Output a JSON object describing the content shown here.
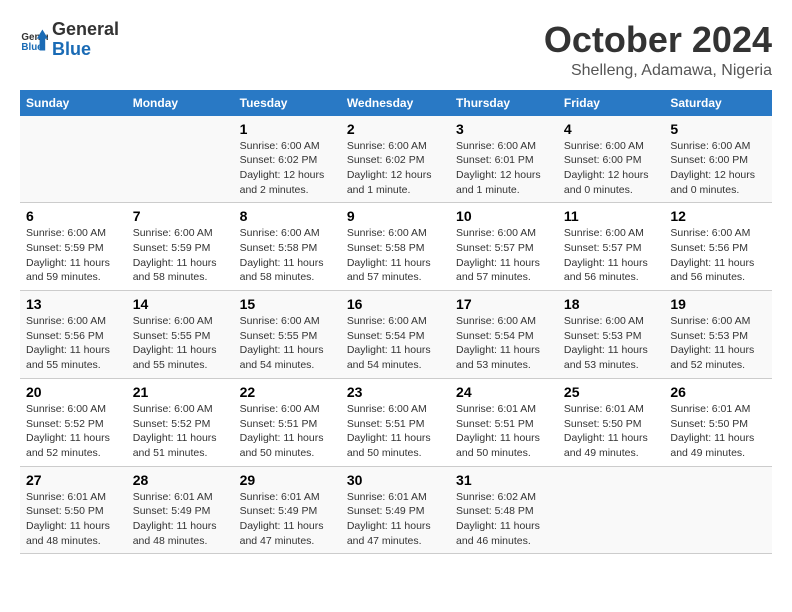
{
  "logo": {
    "line1": "General",
    "line2": "Blue"
  },
  "title": "October 2024",
  "subtitle": "Shelleng, Adamawa, Nigeria",
  "headers": [
    "Sunday",
    "Monday",
    "Tuesday",
    "Wednesday",
    "Thursday",
    "Friday",
    "Saturday"
  ],
  "weeks": [
    [
      {
        "day": "",
        "sunrise": "",
        "sunset": "",
        "daylight": ""
      },
      {
        "day": "",
        "sunrise": "",
        "sunset": "",
        "daylight": ""
      },
      {
        "day": "1",
        "sunrise": "Sunrise: 6:00 AM",
        "sunset": "Sunset: 6:02 PM",
        "daylight": "Daylight: 12 hours and 2 minutes."
      },
      {
        "day": "2",
        "sunrise": "Sunrise: 6:00 AM",
        "sunset": "Sunset: 6:02 PM",
        "daylight": "Daylight: 12 hours and 1 minute."
      },
      {
        "day": "3",
        "sunrise": "Sunrise: 6:00 AM",
        "sunset": "Sunset: 6:01 PM",
        "daylight": "Daylight: 12 hours and 1 minute."
      },
      {
        "day": "4",
        "sunrise": "Sunrise: 6:00 AM",
        "sunset": "Sunset: 6:00 PM",
        "daylight": "Daylight: 12 hours and 0 minutes."
      },
      {
        "day": "5",
        "sunrise": "Sunrise: 6:00 AM",
        "sunset": "Sunset: 6:00 PM",
        "daylight": "Daylight: 12 hours and 0 minutes."
      }
    ],
    [
      {
        "day": "6",
        "sunrise": "Sunrise: 6:00 AM",
        "sunset": "Sunset: 5:59 PM",
        "daylight": "Daylight: 11 hours and 59 minutes."
      },
      {
        "day": "7",
        "sunrise": "Sunrise: 6:00 AM",
        "sunset": "Sunset: 5:59 PM",
        "daylight": "Daylight: 11 hours and 58 minutes."
      },
      {
        "day": "8",
        "sunrise": "Sunrise: 6:00 AM",
        "sunset": "Sunset: 5:58 PM",
        "daylight": "Daylight: 11 hours and 58 minutes."
      },
      {
        "day": "9",
        "sunrise": "Sunrise: 6:00 AM",
        "sunset": "Sunset: 5:58 PM",
        "daylight": "Daylight: 11 hours and 57 minutes."
      },
      {
        "day": "10",
        "sunrise": "Sunrise: 6:00 AM",
        "sunset": "Sunset: 5:57 PM",
        "daylight": "Daylight: 11 hours and 57 minutes."
      },
      {
        "day": "11",
        "sunrise": "Sunrise: 6:00 AM",
        "sunset": "Sunset: 5:57 PM",
        "daylight": "Daylight: 11 hours and 56 minutes."
      },
      {
        "day": "12",
        "sunrise": "Sunrise: 6:00 AM",
        "sunset": "Sunset: 5:56 PM",
        "daylight": "Daylight: 11 hours and 56 minutes."
      }
    ],
    [
      {
        "day": "13",
        "sunrise": "Sunrise: 6:00 AM",
        "sunset": "Sunset: 5:56 PM",
        "daylight": "Daylight: 11 hours and 55 minutes."
      },
      {
        "day": "14",
        "sunrise": "Sunrise: 6:00 AM",
        "sunset": "Sunset: 5:55 PM",
        "daylight": "Daylight: 11 hours and 55 minutes."
      },
      {
        "day": "15",
        "sunrise": "Sunrise: 6:00 AM",
        "sunset": "Sunset: 5:55 PM",
        "daylight": "Daylight: 11 hours and 54 minutes."
      },
      {
        "day": "16",
        "sunrise": "Sunrise: 6:00 AM",
        "sunset": "Sunset: 5:54 PM",
        "daylight": "Daylight: 11 hours and 54 minutes."
      },
      {
        "day": "17",
        "sunrise": "Sunrise: 6:00 AM",
        "sunset": "Sunset: 5:54 PM",
        "daylight": "Daylight: 11 hours and 53 minutes."
      },
      {
        "day": "18",
        "sunrise": "Sunrise: 6:00 AM",
        "sunset": "Sunset: 5:53 PM",
        "daylight": "Daylight: 11 hours and 53 minutes."
      },
      {
        "day": "19",
        "sunrise": "Sunrise: 6:00 AM",
        "sunset": "Sunset: 5:53 PM",
        "daylight": "Daylight: 11 hours and 52 minutes."
      }
    ],
    [
      {
        "day": "20",
        "sunrise": "Sunrise: 6:00 AM",
        "sunset": "Sunset: 5:52 PM",
        "daylight": "Daylight: 11 hours and 52 minutes."
      },
      {
        "day": "21",
        "sunrise": "Sunrise: 6:00 AM",
        "sunset": "Sunset: 5:52 PM",
        "daylight": "Daylight: 11 hours and 51 minutes."
      },
      {
        "day": "22",
        "sunrise": "Sunrise: 6:00 AM",
        "sunset": "Sunset: 5:51 PM",
        "daylight": "Daylight: 11 hours and 50 minutes."
      },
      {
        "day": "23",
        "sunrise": "Sunrise: 6:00 AM",
        "sunset": "Sunset: 5:51 PM",
        "daylight": "Daylight: 11 hours and 50 minutes."
      },
      {
        "day": "24",
        "sunrise": "Sunrise: 6:01 AM",
        "sunset": "Sunset: 5:51 PM",
        "daylight": "Daylight: 11 hours and 50 minutes."
      },
      {
        "day": "25",
        "sunrise": "Sunrise: 6:01 AM",
        "sunset": "Sunset: 5:50 PM",
        "daylight": "Daylight: 11 hours and 49 minutes."
      },
      {
        "day": "26",
        "sunrise": "Sunrise: 6:01 AM",
        "sunset": "Sunset: 5:50 PM",
        "daylight": "Daylight: 11 hours and 49 minutes."
      }
    ],
    [
      {
        "day": "27",
        "sunrise": "Sunrise: 6:01 AM",
        "sunset": "Sunset: 5:50 PM",
        "daylight": "Daylight: 11 hours and 48 minutes."
      },
      {
        "day": "28",
        "sunrise": "Sunrise: 6:01 AM",
        "sunset": "Sunset: 5:49 PM",
        "daylight": "Daylight: 11 hours and 48 minutes."
      },
      {
        "day": "29",
        "sunrise": "Sunrise: 6:01 AM",
        "sunset": "Sunset: 5:49 PM",
        "daylight": "Daylight: 11 hours and 47 minutes."
      },
      {
        "day": "30",
        "sunrise": "Sunrise: 6:01 AM",
        "sunset": "Sunset: 5:49 PM",
        "daylight": "Daylight: 11 hours and 47 minutes."
      },
      {
        "day": "31",
        "sunrise": "Sunrise: 6:02 AM",
        "sunset": "Sunset: 5:48 PM",
        "daylight": "Daylight: 11 hours and 46 minutes."
      },
      {
        "day": "",
        "sunrise": "",
        "sunset": "",
        "daylight": ""
      },
      {
        "day": "",
        "sunrise": "",
        "sunset": "",
        "daylight": ""
      }
    ]
  ]
}
